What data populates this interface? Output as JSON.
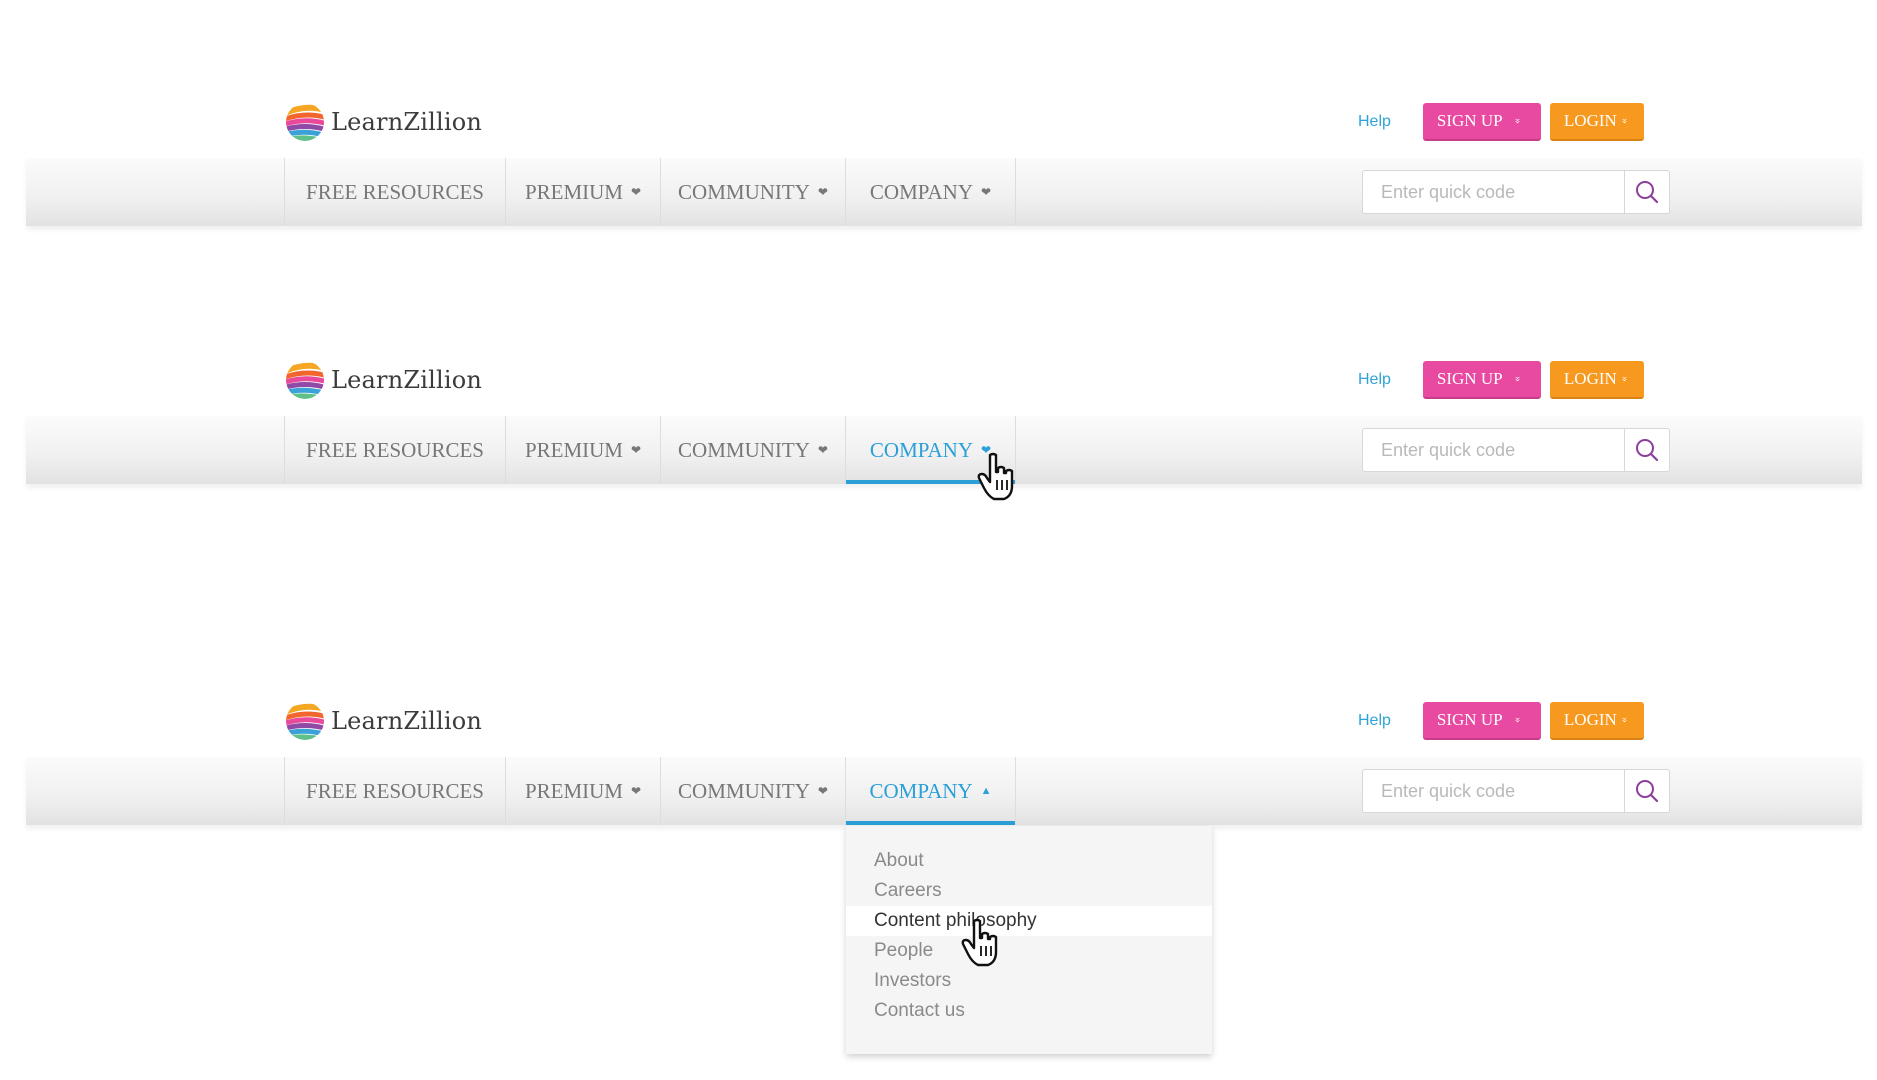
{
  "brand": {
    "name": "LearnZillion"
  },
  "header": {
    "help_label": "Help",
    "signup_label": "SIGN UP",
    "login_label": "LOGIN",
    "chevron": "»"
  },
  "nav": {
    "items": [
      {
        "label": "FREE RESOURCES"
      },
      {
        "label": "PREMIUM",
        "caret": "❤"
      },
      {
        "label": "COMMUNITY",
        "caret": "❤"
      },
      {
        "label": "COMPANY",
        "caret": "❤"
      }
    ],
    "open_caret": "▲"
  },
  "search": {
    "placeholder": "Enter quick code",
    "icon": "search-icon"
  },
  "states": [
    {
      "active": "none",
      "dropdown_open": false
    },
    {
      "active": "COMPANY",
      "dropdown_open": false
    },
    {
      "active": "COMPANY",
      "dropdown_open": true
    }
  ],
  "dropdown": {
    "items": [
      "About",
      "Careers",
      "Content philosophy",
      "People",
      "Investors",
      "Contact us"
    ],
    "hovered": "Content philosophy"
  },
  "colors": {
    "accent": "#2a9fd8",
    "signup": "#e74aa0",
    "login": "#f7981f",
    "search_icon": "#8b3f9a"
  }
}
